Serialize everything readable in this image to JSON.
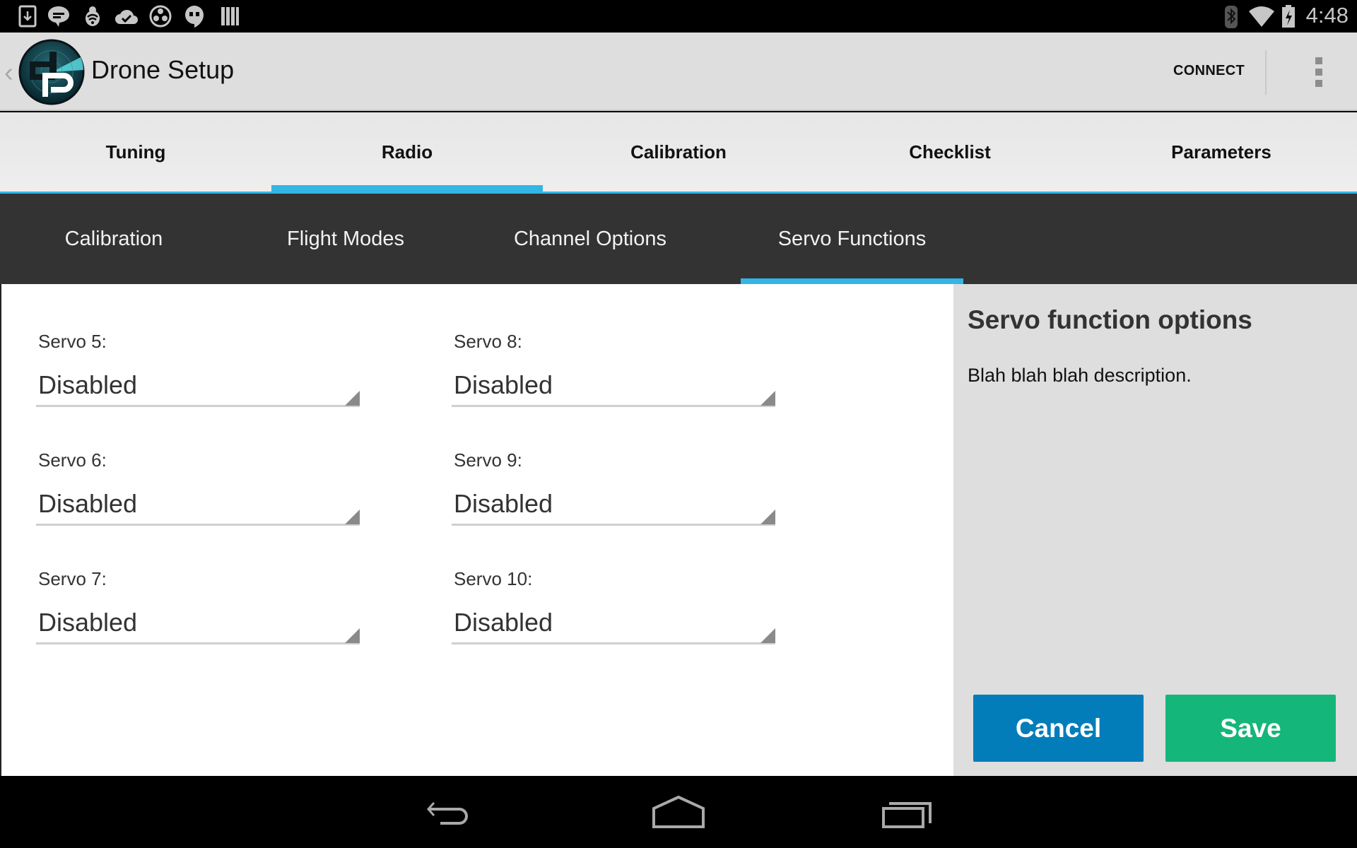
{
  "status_bar": {
    "left_icons": [
      "download-icon",
      "sms-icon",
      "bug-wifi-icon",
      "cloud-check-icon",
      "film-reel-icon",
      "hangouts-icon",
      "barcode-icon"
    ],
    "right_icons": [
      "bluetooth-icon",
      "wifi-icon",
      "battery-charging-icon"
    ],
    "time": "4:48"
  },
  "action_bar": {
    "title": "Drone Setup",
    "connect_label": "CONNECT"
  },
  "main_tabs": [
    {
      "label": "Tuning",
      "active": false
    },
    {
      "label": "Radio",
      "active": true
    },
    {
      "label": "Calibration",
      "active": false
    },
    {
      "label": "Checklist",
      "active": false
    },
    {
      "label": "Parameters",
      "active": false
    }
  ],
  "sub_tabs": [
    {
      "label": "Calibration",
      "active": false
    },
    {
      "label": "Flight Modes",
      "active": false
    },
    {
      "label": "Channel Options",
      "active": false
    },
    {
      "label": "Servo Functions",
      "active": true
    }
  ],
  "servos": [
    {
      "label": "Servo 5:",
      "value": "Disabled"
    },
    {
      "label": "Servo 6:",
      "value": "Disabled"
    },
    {
      "label": "Servo 7:",
      "value": "Disabled"
    },
    {
      "label": "Servo 8:",
      "value": "Disabled"
    },
    {
      "label": "Servo 9:",
      "value": "Disabled"
    },
    {
      "label": "Servo 10:",
      "value": "Disabled"
    }
  ],
  "side_panel": {
    "title": "Servo function options",
    "description": "Blah blah blah description.",
    "cancel_label": "Cancel",
    "save_label": "Save"
  },
  "colors": {
    "accent": "#33b5e5",
    "cancel": "#027dba",
    "save": "#15b67a",
    "sub_tab_bg": "#333333"
  }
}
